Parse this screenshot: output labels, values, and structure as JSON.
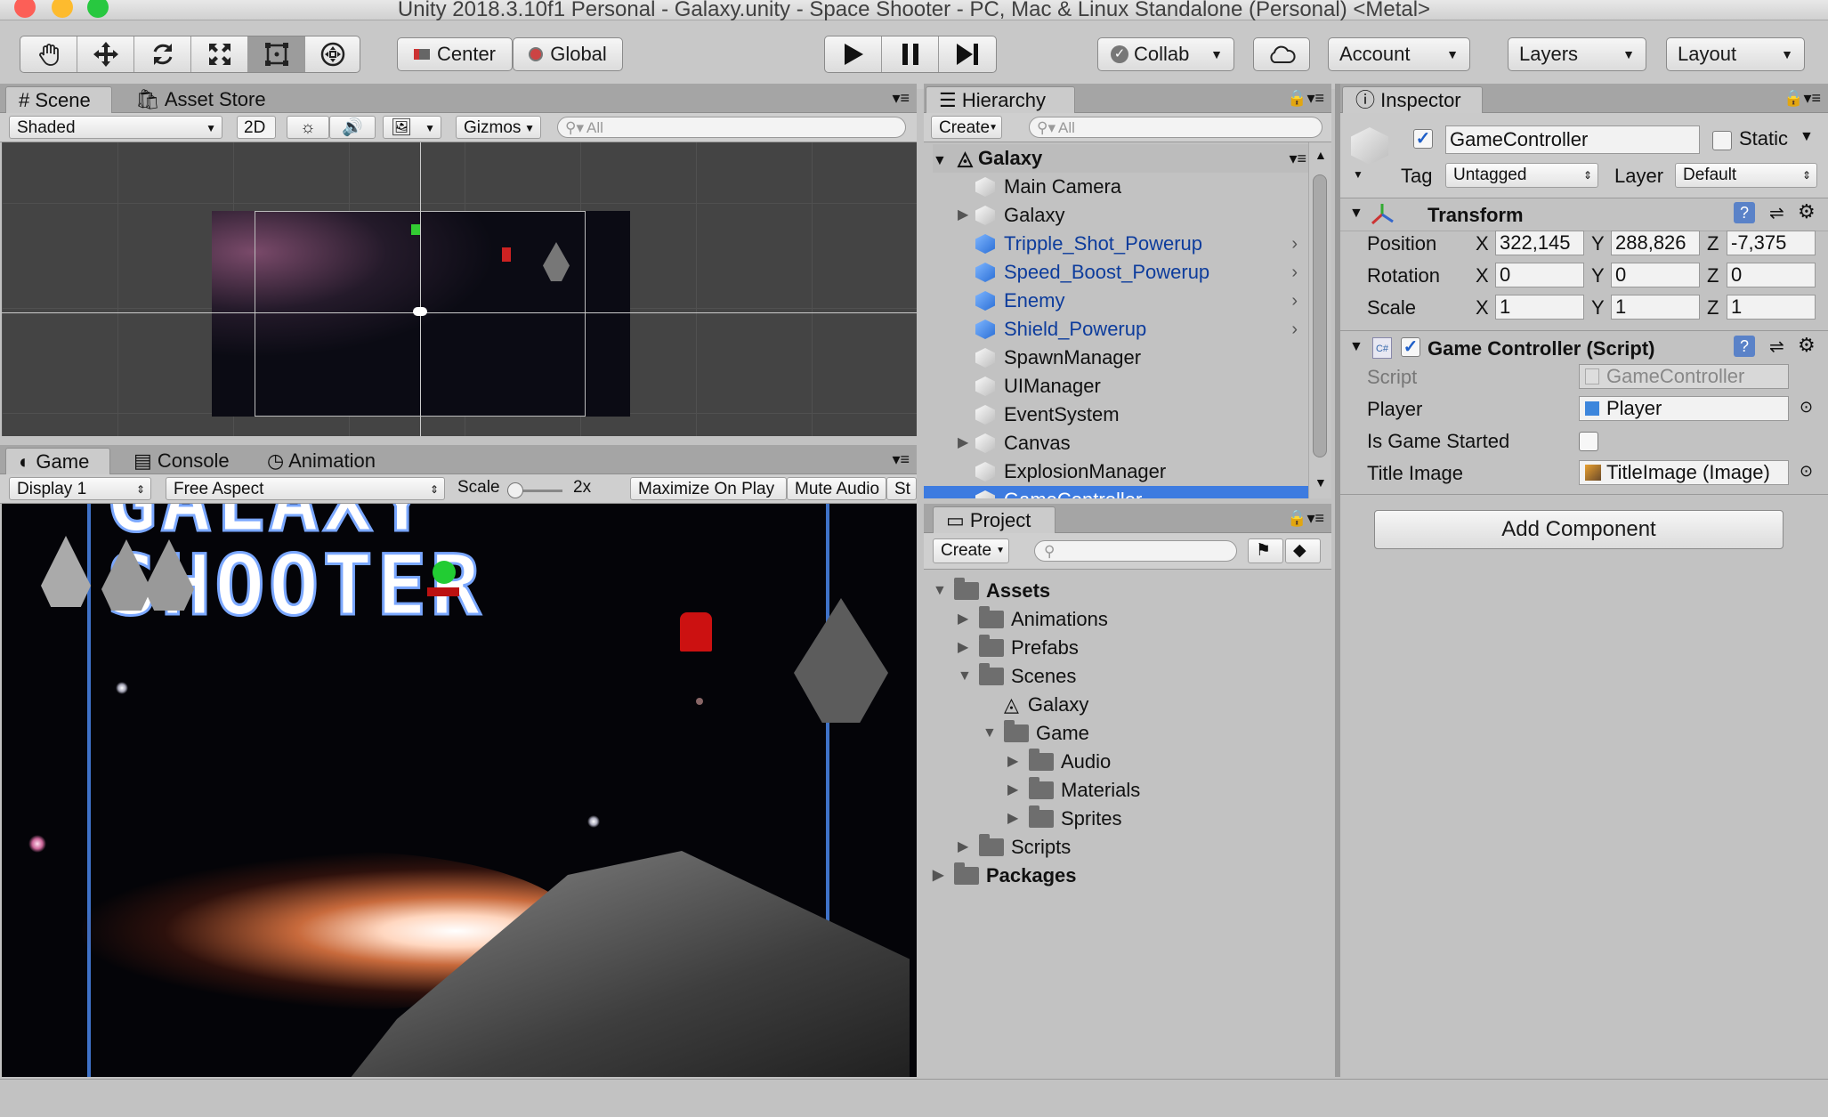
{
  "window": {
    "title": "Unity 2018.3.10f1 Personal - Galaxy.unity - Space Shooter - PC, Mac & Linux Standalone (Personal) <Metal>"
  },
  "toolbar": {
    "pivot": "Center",
    "space": "Global",
    "collab": "Collab",
    "account": "Account",
    "layers": "Layers",
    "layout": "Layout"
  },
  "scene_panel": {
    "tabs": [
      "Scene",
      "Asset Store"
    ],
    "shading": "Shaded",
    "mode_2d": "2D",
    "gizmos": "Gizmos",
    "search_placeholder": "All"
  },
  "game_panel": {
    "tabs": [
      "Game",
      "Console",
      "Animation"
    ],
    "display": "Display 1",
    "aspect": "Free Aspect",
    "scale_label": "Scale",
    "scale_value": "2x",
    "maximize": "Maximize On Play",
    "mute": "Mute Audio",
    "stats": "St",
    "logo_line1": "GALAXY",
    "logo_line2": "SHOOTER"
  },
  "hierarchy": {
    "tab": "Hierarchy",
    "create": "Create",
    "search_placeholder": "All",
    "scene": "Galaxy",
    "items": [
      {
        "label": "Main Camera",
        "prefab": false,
        "expandable": false
      },
      {
        "label": "Galaxy",
        "prefab": false,
        "expandable": true
      },
      {
        "label": "Tripple_Shot_Powerup",
        "prefab": true,
        "expandable": false
      },
      {
        "label": "Speed_Boost_Powerup",
        "prefab": true,
        "expandable": false
      },
      {
        "label": "Enemy",
        "prefab": true,
        "expandable": false
      },
      {
        "label": "Shield_Powerup",
        "prefab": true,
        "expandable": false
      },
      {
        "label": "SpawnManager",
        "prefab": false,
        "expandable": false
      },
      {
        "label": "UIManager",
        "prefab": false,
        "expandable": false
      },
      {
        "label": "EventSystem",
        "prefab": false,
        "expandable": false
      },
      {
        "label": "Canvas",
        "prefab": false,
        "expandable": true
      },
      {
        "label": "ExplosionManager",
        "prefab": false,
        "expandable": false
      },
      {
        "label": "GameController",
        "prefab": false,
        "expandable": false
      }
    ]
  },
  "project": {
    "tab": "Project",
    "create": "Create",
    "tree": [
      {
        "label": "Assets",
        "depth": 0,
        "bold": true,
        "state": "open",
        "kind": "folder"
      },
      {
        "label": "Animations",
        "depth": 1,
        "bold": false,
        "state": "closed",
        "kind": "folder"
      },
      {
        "label": "Prefabs",
        "depth": 1,
        "bold": false,
        "state": "closed",
        "kind": "folder"
      },
      {
        "label": "Scenes",
        "depth": 1,
        "bold": false,
        "state": "open",
        "kind": "folder"
      },
      {
        "label": "Galaxy",
        "depth": 2,
        "bold": false,
        "state": "none",
        "kind": "scene"
      },
      {
        "label": "Game",
        "depth": 2,
        "bold": false,
        "state": "open",
        "kind": "folder"
      },
      {
        "label": "Audio",
        "depth": 3,
        "bold": false,
        "state": "closed",
        "kind": "folder"
      },
      {
        "label": "Materials",
        "depth": 3,
        "bold": false,
        "state": "closed",
        "kind": "folder"
      },
      {
        "label": "Sprites",
        "depth": 3,
        "bold": false,
        "state": "closed",
        "kind": "folder"
      },
      {
        "label": "Scripts",
        "depth": 1,
        "bold": false,
        "state": "closed",
        "kind": "folder"
      },
      {
        "label": "Packages",
        "depth": 0,
        "bold": true,
        "state": "closed",
        "kind": "folder"
      }
    ]
  },
  "inspector": {
    "tab": "Inspector",
    "object_name": "GameController",
    "static_label": "Static",
    "tag_label": "Tag",
    "tag_value": "Untagged",
    "layer_label": "Layer",
    "layer_value": "Default",
    "transform": {
      "title": "Transform",
      "position_label": "Position",
      "rotation_label": "Rotation",
      "scale_label": "Scale",
      "position": [
        "322,145",
        "288,826",
        "-7,375"
      ],
      "rotation": [
        "0",
        "0",
        "0"
      ],
      "scale": [
        "1",
        "1",
        "1"
      ]
    },
    "script_component": {
      "title": "Game Controller (Script)",
      "script_label": "Script",
      "script_value": "GameController",
      "player_label": "Player",
      "player_value": "Player",
      "started_label": "Is Game Started",
      "title_image_label": "Title Image",
      "title_image_value": "TitleImage (Image)"
    },
    "add_component": "Add Component"
  },
  "axes": [
    "X",
    "Y",
    "Z"
  ],
  "colors": {
    "selection": "#3d7be0",
    "prefab_text": "#0d3c9c",
    "panel_bg": "#c2c2c2",
    "tab_bar": "#a5a5a5"
  }
}
